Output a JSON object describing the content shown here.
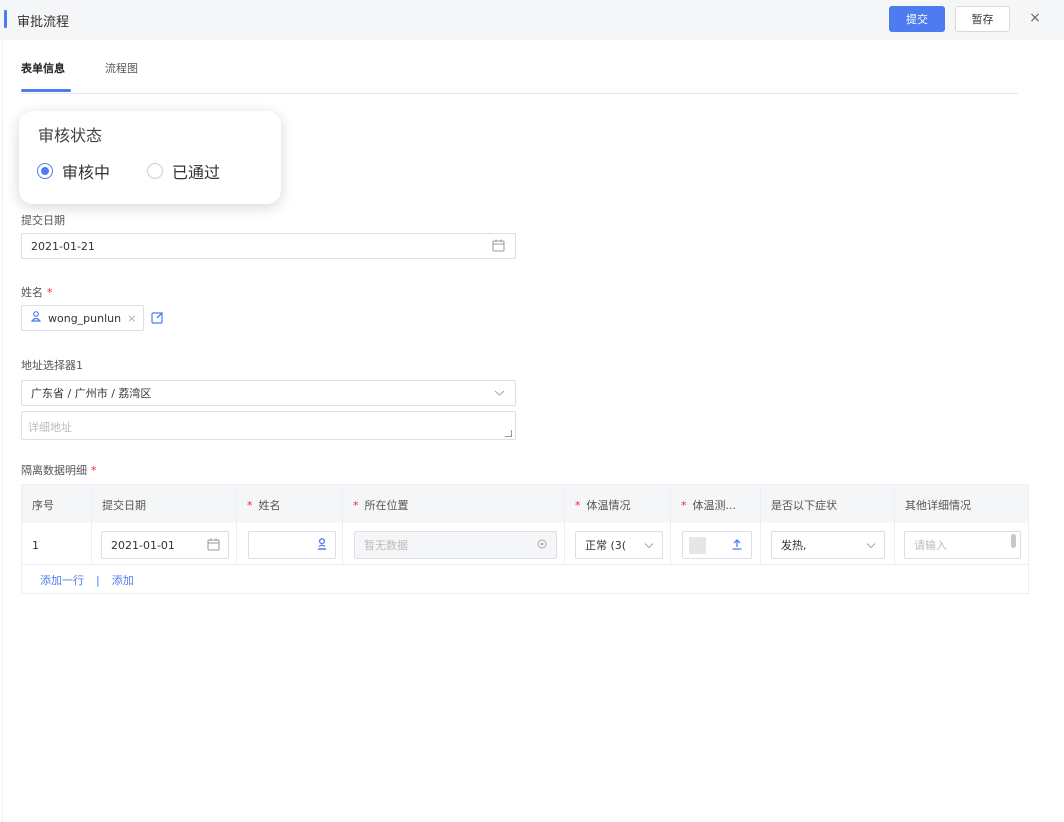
{
  "window": {
    "title": "审批流程",
    "submit_label": "提交",
    "draft_label": "暂存",
    "close_glyph": "×"
  },
  "tabs": [
    {
      "label": "表单信息",
      "active": true
    },
    {
      "label": "流程图",
      "active": false
    }
  ],
  "status_popup": {
    "title": "审核状态",
    "options": [
      {
        "label": "审核中",
        "selected": true
      },
      {
        "label": "已通过",
        "selected": false
      }
    ]
  },
  "form": {
    "submit_date": {
      "label": "提交日期",
      "value": "2021-01-21"
    },
    "name": {
      "label": "姓名",
      "required_mark": "*",
      "user": "wong_punlun",
      "remove_glyph": "×"
    },
    "address": {
      "label": "地址选择器1",
      "value": "广东省 / 广州市 / 荔湾区",
      "detail_placeholder": "详细地址"
    },
    "detail_table": {
      "label": "隔离数据明细",
      "required_mark": "*",
      "columns": [
        "序号",
        "提交日期",
        "姓名",
        "所在位置",
        "体温情况",
        "体温测...",
        "是否以下症状",
        "其他详细情况"
      ],
      "required_columns": [
        false,
        false,
        true,
        true,
        true,
        true,
        false,
        false
      ],
      "rows": [
        {
          "index": "1",
          "date": "2021-01-01",
          "name": "",
          "location_placeholder": "暂无数据",
          "temp_status": "正常 (3(",
          "symptoms": "发热,",
          "other_placeholder": "请输入"
        }
      ],
      "add_row_label": "添加一行",
      "separator": "|",
      "add_label": "添加"
    }
  },
  "colors": {
    "accent": "#4c7cf0",
    "required": "#f5222d",
    "header_bg": "#f5f6f8"
  }
}
